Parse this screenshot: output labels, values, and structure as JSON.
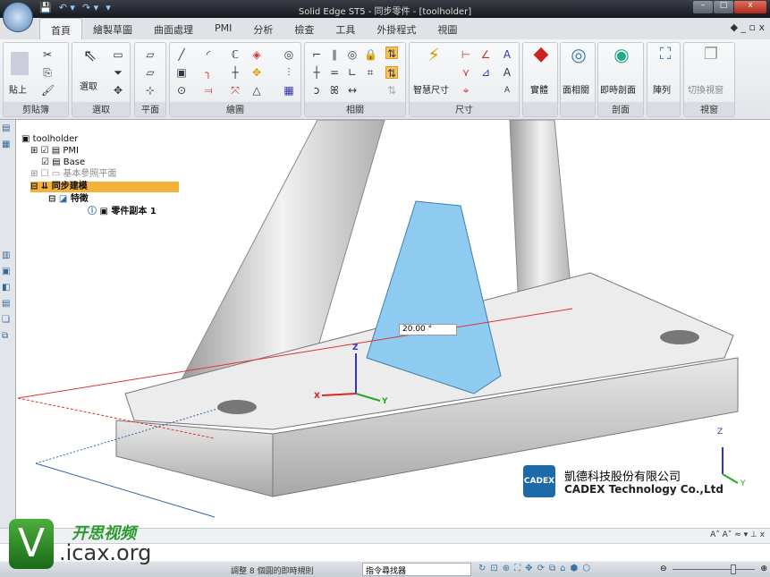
{
  "window": {
    "title": "Solid Edge ST5 - 同步零件 - [toolholder]",
    "min": "–",
    "max": "□",
    "close": "x"
  },
  "qat": [
    "💾",
    "↶ ▾",
    "↷ ▾",
    "▾"
  ],
  "tabs": [
    "首頁",
    "繪製草圖",
    "曲面處理",
    "PMI",
    "分析",
    "檢查",
    "工具",
    "外掛程式",
    "視圖"
  ],
  "tabs_right": "◆ _ ▫ x",
  "ribbon": {
    "groups": [
      "剪貼簿",
      "選取",
      "平面",
      "繪圖",
      "相關",
      "尺寸",
      "",
      "",
      "剖面",
      "",
      "視窗"
    ],
    "paste": "貼上",
    "select": "選取",
    "smart_dim": "智慧尺寸",
    "solids": "實體",
    "face_rel": "面相關",
    "live_section": "即時剖面",
    "pattern": "陣列",
    "switch_window": "切換視窗"
  },
  "tree": {
    "root": "toolholder",
    "pmi": "PMI",
    "base": "Base",
    "ref_planes": "基本參照平面",
    "sync": "同步建模",
    "features": "特徵",
    "part_copy": "零件副本 1"
  },
  "dimension": "20.00 °",
  "axes": {
    "x": "X",
    "y": "Y",
    "z": "Z"
  },
  "cadex": {
    "logo": "CADEX",
    "name_cn": "凱德科技股份有限公司",
    "name_en": "CADEX Technology Co.,Ltd"
  },
  "watermark": {
    "logo": "V",
    "cn": "开思视频",
    "url": ".icax.org"
  },
  "command_bar_icons": "A˄ A˅ ≈ ▾ ⊥ x",
  "status": {
    "message": "調整 8 個圓的即時規則",
    "finder": "指令尋找器",
    "zoom_level": 0.75
  }
}
